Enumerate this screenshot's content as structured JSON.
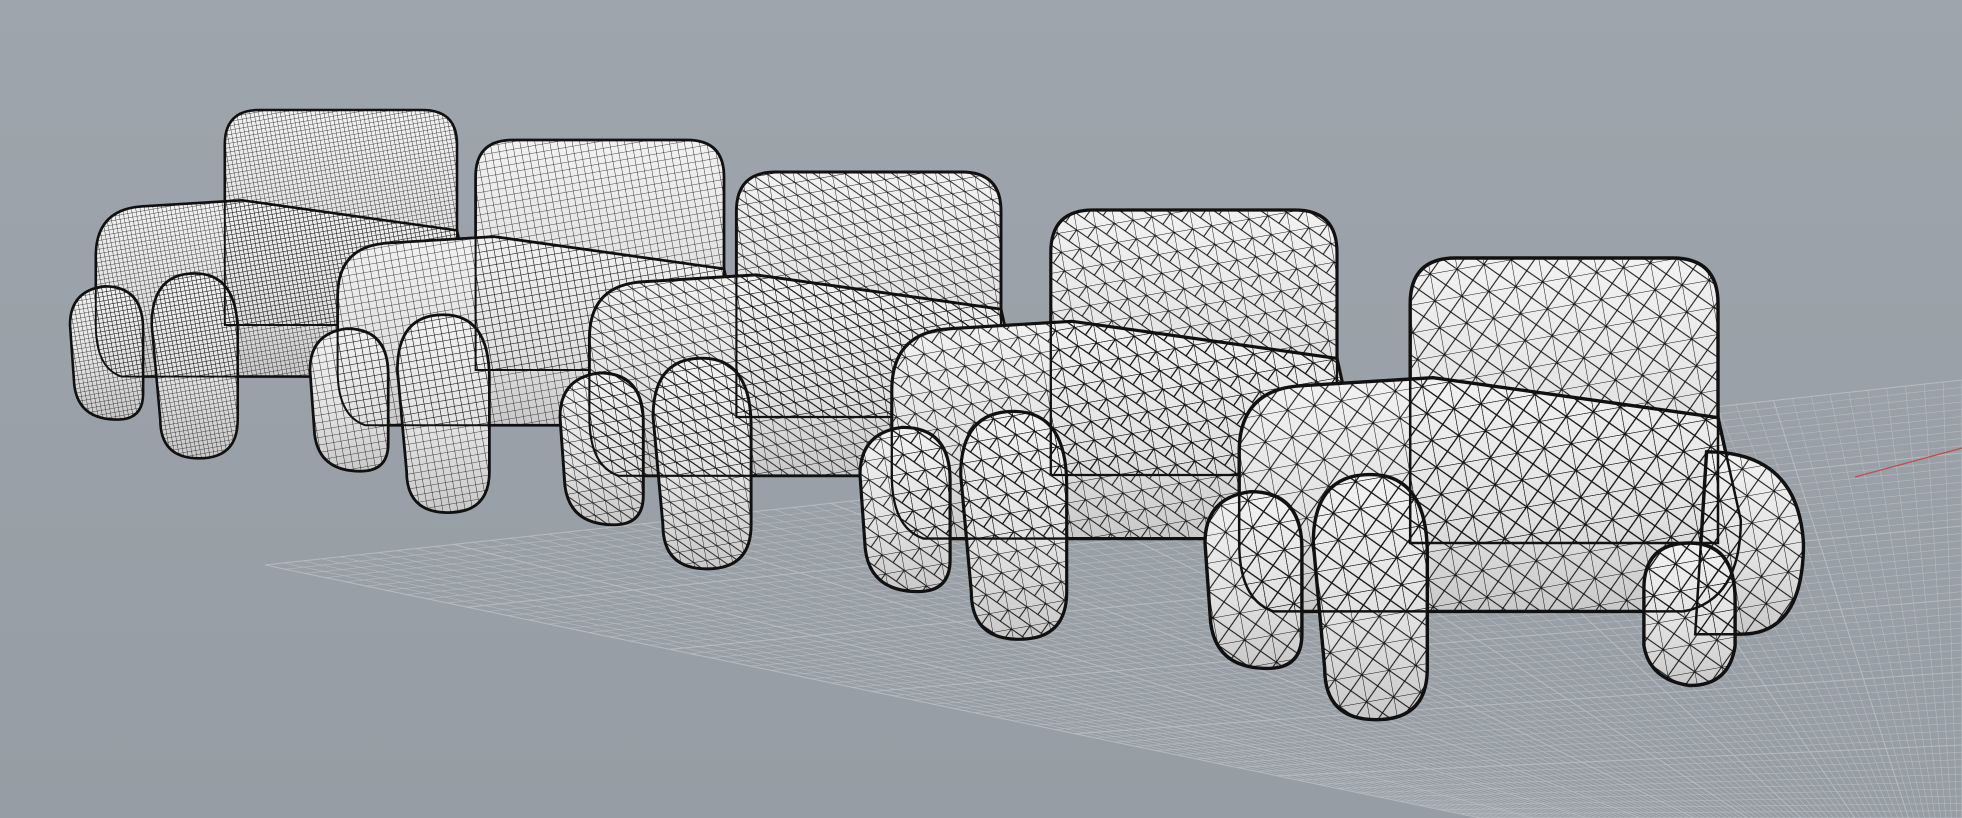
{
  "viewport": {
    "background_color": "#9ba2a9",
    "grid_color": "#b9bfc4",
    "x_axis_color": "#c0504d",
    "mesh_fill_color": "#e4e4e4",
    "mesh_wire_color": "#111111"
  },
  "models": [
    {
      "detail": "highest"
    },
    {
      "detail": "high"
    },
    {
      "detail": "medium"
    },
    {
      "detail": "low"
    },
    {
      "detail": "lowest"
    }
  ]
}
